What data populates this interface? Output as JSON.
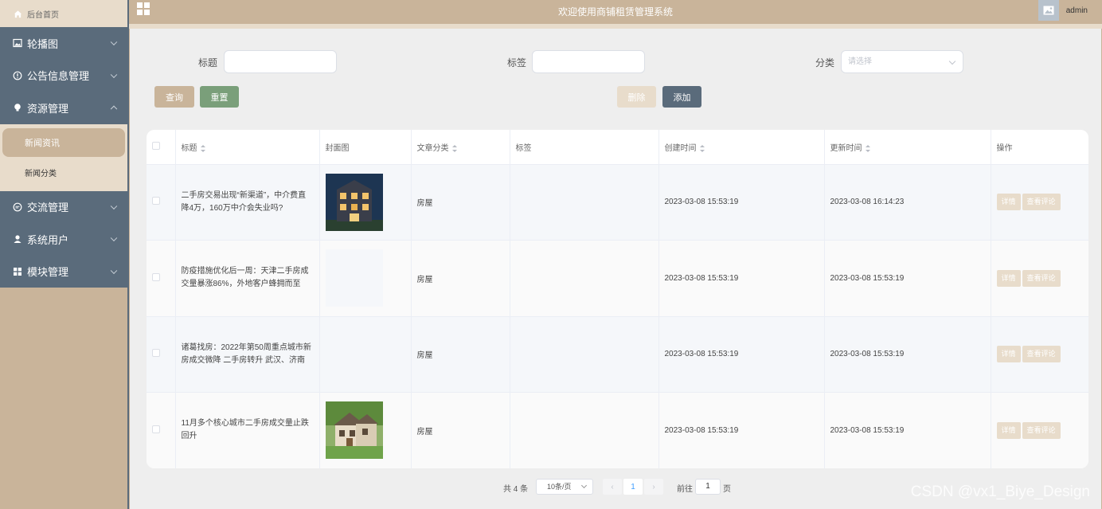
{
  "sidebar": {
    "home_label": "后台首页",
    "menu": [
      {
        "label": "轮播图",
        "icon": "image-icon"
      },
      {
        "label": "公告信息管理",
        "icon": "info-icon"
      },
      {
        "label": "资源管理",
        "icon": "bulb-icon"
      }
    ],
    "submenu": [
      {
        "label": "新闻资讯"
      },
      {
        "label": "新闻分类"
      }
    ],
    "menu_after": [
      {
        "label": "交流管理",
        "icon": "chat-icon"
      },
      {
        "label": "系统用户",
        "icon": "user-icon"
      },
      {
        "label": "模块管理",
        "icon": "grid-icon"
      }
    ]
  },
  "header": {
    "title": "欢迎使用商铺租赁管理系统",
    "user": "admin"
  },
  "search": {
    "title_label": "标题",
    "tag_label": "标签",
    "category_label": "分类",
    "category_placeholder": "请选择",
    "query_button": "查询",
    "reset_button": "重置",
    "delete_button": "删除",
    "add_button": "添加"
  },
  "table": {
    "headers": {
      "title": "标题",
      "cover": "封面图",
      "category": "文章分类",
      "tag": "标签",
      "created": "创建时间",
      "updated": "更新时间",
      "actions": "操作"
    },
    "rows": [
      {
        "title": "二手房交易出现“新渠道”，中介费直降4万，160万中介会失业吗?",
        "cover": "night-house",
        "category": "房屋",
        "tag": "",
        "created": "2023-03-08 15:53:19",
        "updated": "2023-03-08 16:14:23"
      },
      {
        "title": "防疫措施优化后一周：天津二手房成交量暴涨86%，外地客户蜂拥而至",
        "cover": "empty",
        "category": "房屋",
        "tag": "",
        "created": "2023-03-08 15:53:19",
        "updated": "2023-03-08 15:53:19"
      },
      {
        "title": "诸葛找房：2022年第50周重点城市新房成交微降 二手房转升 武汉、济南",
        "cover": "empty",
        "category": "房屋",
        "tag": "",
        "created": "2023-03-08 15:53:19",
        "updated": "2023-03-08 15:53:19"
      },
      {
        "title": "11月多个核心城市二手房成交量止跌回升",
        "cover": "day-house",
        "category": "房屋",
        "tag": "",
        "created": "2023-03-08 15:53:19",
        "updated": "2023-03-08 15:53:19"
      }
    ],
    "detail_button": "详情",
    "comment_button": "查看评论"
  },
  "pagination": {
    "total": "共 4 条",
    "page_size": "10条/页",
    "current": "1",
    "goto_label": "前往",
    "goto_value": "1",
    "page_label": "页"
  },
  "watermark": "CSDN @vx1_Biye_Design",
  "colors": {
    "primary": "#c9b49a",
    "sidebar": "#5a6b7b",
    "reset": "#7a9f7a",
    "active_page": "#409eff"
  }
}
